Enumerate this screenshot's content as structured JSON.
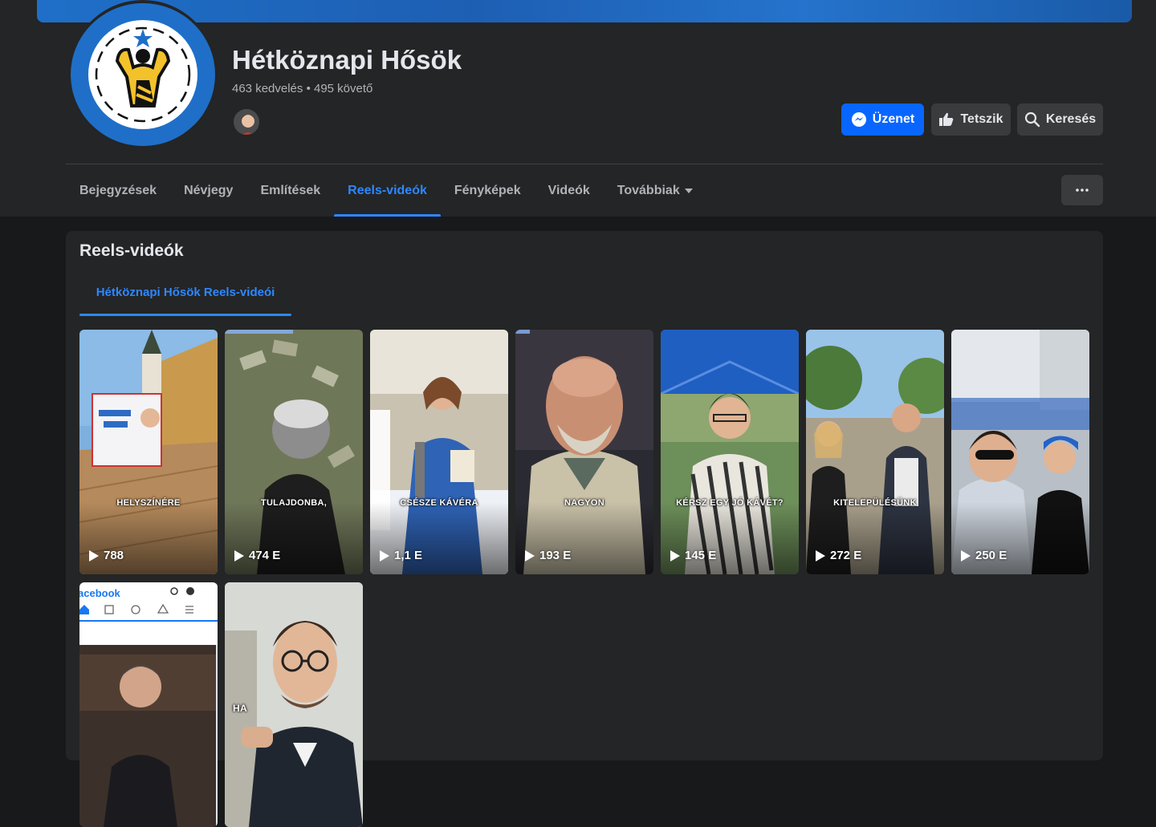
{
  "page": {
    "name": "Hétköznapi Hősök",
    "stats": "463 kedvelés • 495 követő"
  },
  "actions": {
    "message_label": "Üzenet",
    "like_label": "Tetszik",
    "search_label": "Keresés"
  },
  "tabs": [
    {
      "label": "Bejegyzések",
      "active": false
    },
    {
      "label": "Névjegy",
      "active": false
    },
    {
      "label": "Említések",
      "active": false
    },
    {
      "label": "Reels-videók",
      "active": true
    },
    {
      "label": "Fényképek",
      "active": false
    },
    {
      "label": "Videók",
      "active": false
    },
    {
      "label": "Továbbiak",
      "active": false
    }
  ],
  "reels_section": {
    "title": "Reels-videók",
    "subtab_label": "Hétköznapi Hősök Reels-videói",
    "reels": [
      {
        "caption": "HELYSZÍNÉRE",
        "views": "788"
      },
      {
        "caption": "TULAJDONBA,",
        "views": "474 E"
      },
      {
        "caption": "CSÉSZE KÁVÉRA",
        "views": "1,1 E"
      },
      {
        "caption": "NAGYON",
        "views": "193 E"
      },
      {
        "caption": "KÉRSZ EGY JÓ KÁVÉT?",
        "views": "145 E"
      },
      {
        "caption": "KITELEPÜLÉSÜNK",
        "views": "272 E"
      },
      {
        "caption": "",
        "views": "250 E"
      },
      {
        "caption": "",
        "views": "",
        "brand": "acebook"
      },
      {
        "caption": "HA",
        "views": ""
      }
    ]
  },
  "colors": {
    "accent": "#2d88ff",
    "primary_button": "#0866ff",
    "surface": "#242526",
    "background": "#18191a"
  },
  "icons": {
    "message": "messenger-icon",
    "like": "thumbs-up-icon",
    "search": "search-icon",
    "more": "ellipsis-icon",
    "dropdown": "caret-down-icon",
    "play": "play-icon"
  }
}
